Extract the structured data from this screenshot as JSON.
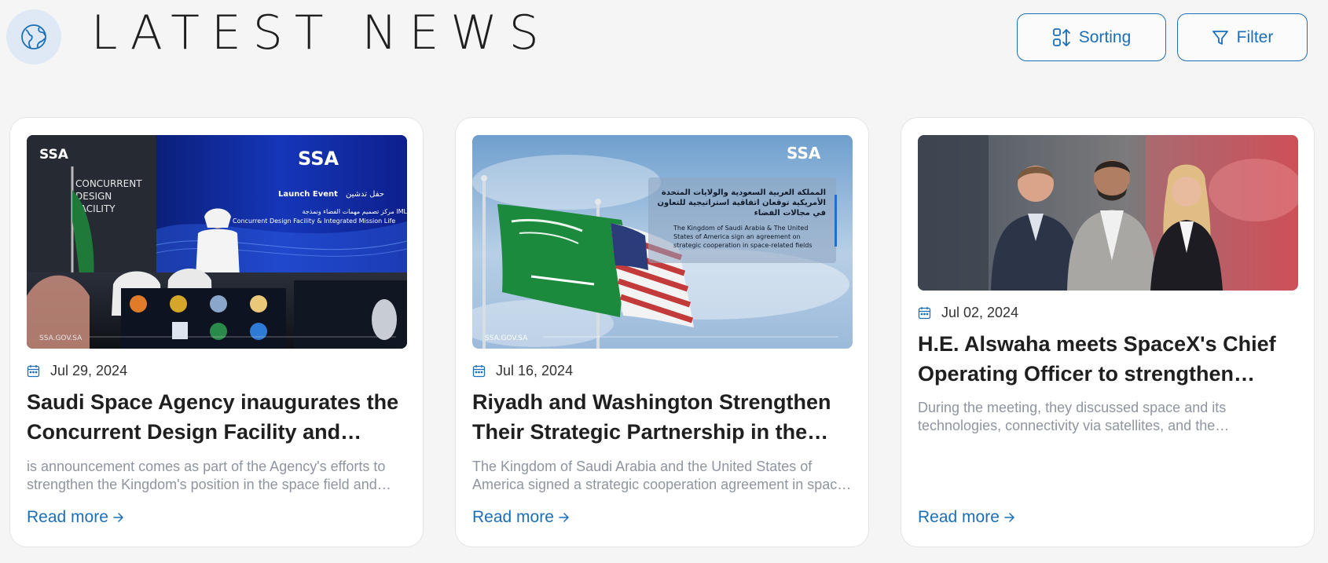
{
  "header": {
    "title": "LATEST NEWS",
    "globe_icon": "globe-icon",
    "sorting_label": "Sorting",
    "sorting_icon": "sort-arrows-icon",
    "filter_label": "Filter",
    "filter_icon": "funnel-icon"
  },
  "colors": {
    "accent": "#1b6fb8",
    "page_background": "#f5f5f5",
    "card_background": "#ffffff",
    "muted_text": "#8f95a0"
  },
  "news": [
    {
      "date": "Jul 29, 2024",
      "title": "Saudi Space Agency inaugurates the Concurrent Design Facility and Integrated Mission Lifecycle",
      "excerpt": "is announcement comes as part of the Agency's efforts to strengthen the Kingdom's position in the space field and develop national capabilities",
      "read_more": "Read more",
      "image": {
        "logo": "SSA",
        "screen_text_en": "Launch Event",
        "screen_text_ar": "حفل تدشين",
        "screen_subtitle_ar": "مركز تصميم مهمات الفضاء ونمذجة IML",
        "screen_subtitle_en": "Concurrent Design Facility & Integrated Mission Life",
        "wall_text_1": "CONCURRENT",
        "wall_text_2": "DESIGN",
        "wall_text_3": "FACILITY",
        "watermark": "SSA.GOV.SA"
      }
    },
    {
      "date": "Jul 16, 2024",
      "title": "Riyadh and Washington Strengthen Their Strategic Partnership in the Space Sector",
      "excerpt": "The Kingdom of Saudi Arabia and the United States of America signed a strategic cooperation agreement in space-related fields",
      "read_more": "Read more",
      "image": {
        "logo": "SSA",
        "caption_ar_1": "المملكة العربية السعودية والولايات المتحدة",
        "caption_ar_2": "الأمريكية توقعان اتفاقية استراتيجية للتعاون",
        "caption_ar_3": "في مجالات الفضاء",
        "caption_en_1": "The Kingdom of Saudi Arabia & The United",
        "caption_en_2": "States of America sign an agreement on",
        "caption_en_3": "strategic cooperation in space-related fields",
        "watermark": "SSA.GOV.SA"
      }
    },
    {
      "date": "Jul 02, 2024",
      "title": "H.E. Alswaha meets SpaceX's Chief Operating Officer to strengthen cooperation",
      "excerpt": "During the meeting, they discussed space and its technologies, connectivity via satellites, and the opportunities for collaboration",
      "read_more": "Read more"
    }
  ]
}
